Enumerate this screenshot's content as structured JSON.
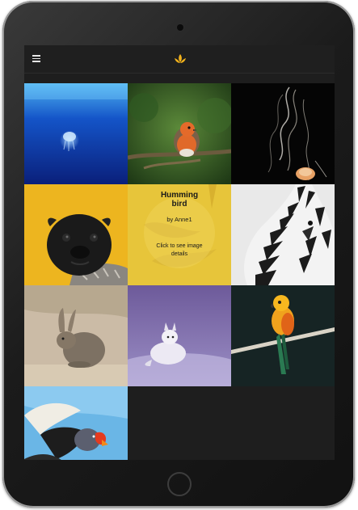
{
  "device": {
    "camera_icon": "camera-icon",
    "home_button_icon": "home-button"
  },
  "topbar": {
    "menu_icon": "hamburger-menu-icon",
    "logo_icon": "lotus-logo-icon",
    "logo_color": "#f2b21c"
  },
  "gallery": {
    "images": [
      {
        "subject": "Jellyfish"
      },
      {
        "subject": "Robin"
      },
      {
        "subject": "Jellyfish"
      },
      {
        "subject": "Pug"
      },
      {
        "subject": "Humming bird",
        "overlay": {
          "title_line1": "Humming",
          "title_line2": "bird",
          "author": "by Anne1",
          "cta_line1": "Click to see image",
          "cta_line2": "details"
        }
      },
      {
        "subject": "Zebra"
      },
      {
        "subject": "Rabbit"
      },
      {
        "subject": "Arctic fox"
      },
      {
        "subject": "Parrot"
      },
      {
        "subject": "Vulture"
      }
    ]
  }
}
